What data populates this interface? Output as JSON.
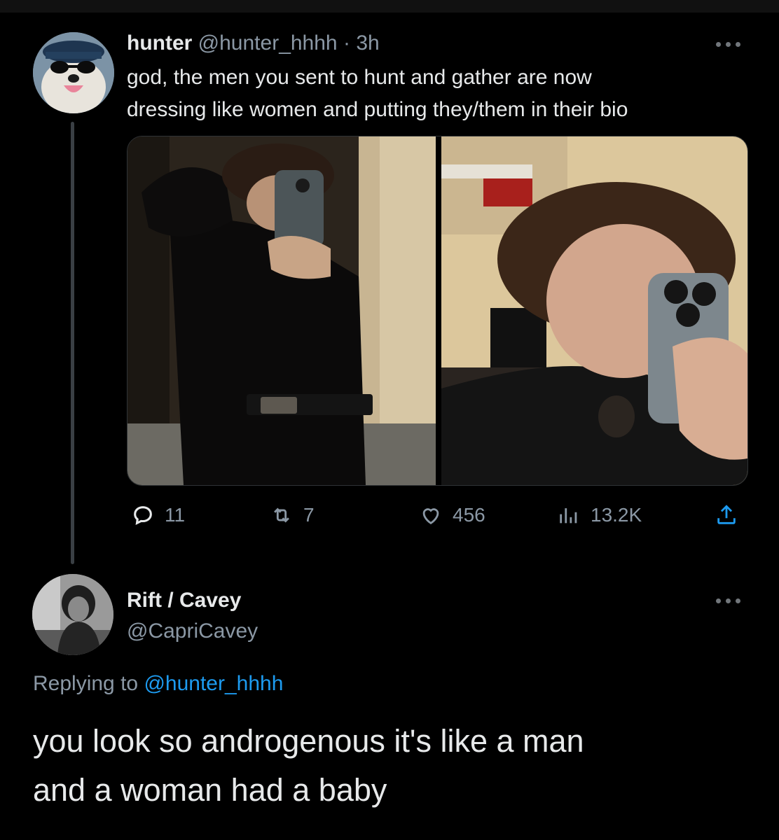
{
  "tweet": {
    "author_name": "hunter",
    "author_handle": "@hunter_hhhh",
    "separator": "·",
    "time": "3h",
    "text_line1": "god, the men you sent to hunt and gather are now",
    "text_line2": "dressing like women and putting they/them in their bio",
    "stats": {
      "replies": "11",
      "retweets": "7",
      "likes": "456",
      "views": "13.2K"
    },
    "photo_left_name": "mirror-selfie-full",
    "photo_right_name": "mirror-selfie-closeup"
  },
  "reply": {
    "author_name": "Rift / Cavey",
    "author_handle": "@CapriCavey",
    "replying_prefix": "Replying to",
    "replying_to": "@hunter_hhhh",
    "text_line1": "you look so androgenous it's like a man",
    "text_line2": "and a woman had a baby"
  },
  "icons": {
    "reply": "reply-icon",
    "retweet": "retweet-icon",
    "like": "heart-icon",
    "views": "views-icon",
    "share": "share-icon",
    "more": "more-icon"
  },
  "colors": {
    "background": "#000000",
    "primary_text": "#e7e9ea",
    "secondary_text": "#8b98a5",
    "link": "#1d9bf0",
    "thread_line": "#3a3f44"
  }
}
